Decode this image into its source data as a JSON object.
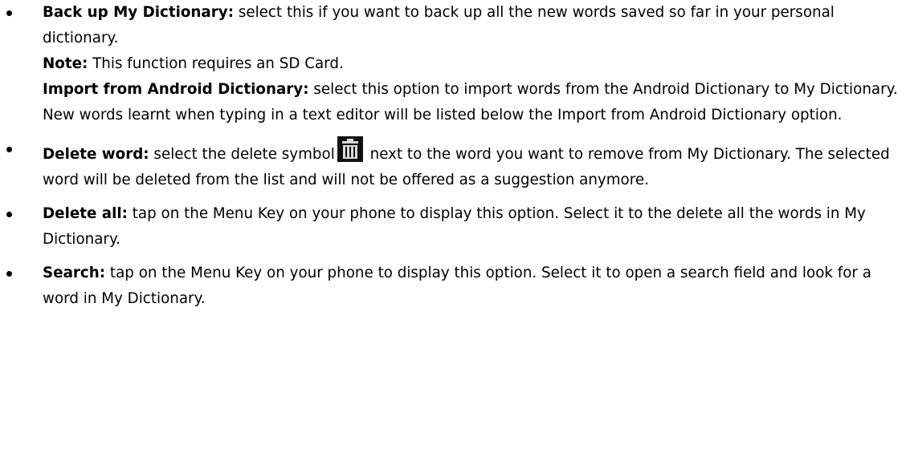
{
  "items": [
    {
      "paragraphs": [
        {
          "label": "Back up My Dictionary:",
          "text": " select this if you want to back up all the new words saved so far in your personal dictionary."
        },
        {
          "label": "Note:",
          "text": " This function requires an SD Card."
        },
        {
          "label": "Import from Android Dictionary:",
          "text": " select this option to import words from the Android Dictionary to My Dictionary. New words learnt when typing in a text editor will be listed below the Import from Android Dictionary option."
        }
      ]
    },
    {
      "label": "Delete word:",
      "text_before_icon": " select the delete symbol",
      "icon": "trash-icon",
      "text_after_icon": " next to the word you want to remove from My Dictionary.  The selected word will be deleted from the list and will not be offered as a suggestion anymore."
    },
    {
      "label": "Delete all:",
      "text": " tap on the Menu Key on your phone to display this option. Select it to the delete all the words in My Dictionary."
    },
    {
      "label": "Search:",
      "text": " tap on the Menu Key on your phone to display this option. Select it to open a search field and look for a word in My Dictionary."
    }
  ],
  "colors": {
    "text": "#000000",
    "icon_background": "#111111",
    "icon_foreground": "#d9d9d9"
  }
}
